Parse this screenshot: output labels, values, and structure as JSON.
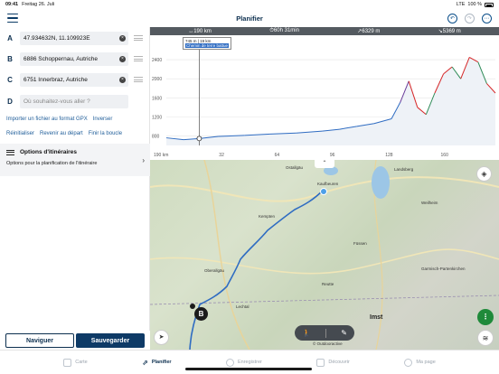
{
  "status": {
    "time": "09:41",
    "date": "Freitag 26. Juli",
    "network": "LTE",
    "battery": "100 %"
  },
  "header": {
    "title": "Planifier"
  },
  "waypoints": [
    {
      "letter": "A",
      "value": "47.934632N, 11.109923E"
    },
    {
      "letter": "B",
      "value": "6886 Schoppernau, Autriche"
    },
    {
      "letter": "C",
      "value": "6751 Innerbraz, Autriche"
    },
    {
      "letter": "D",
      "placeholder": "Où souhaitez-vous aller ?"
    }
  ],
  "links": {
    "import_gpx": "Importer un fichier au format GPX",
    "reverse": "Inverser",
    "reset": "Réinitialiser",
    "back_start": "Revenir au départ",
    "loop": "Finir la boucle"
  },
  "options": {
    "title": "Options d'itinéraires",
    "subtitle": "Options pour la planification de l'itinéraire"
  },
  "buttons": {
    "navigate": "Naviguer",
    "save": "Sauvegarder"
  },
  "stats": {
    "distance": "↔190 km",
    "duration": "⏱60h 31min",
    "ascent": "↗6329 m",
    "descent": "↘5369 m"
  },
  "profile": {
    "tooltip_line1": "745 m | 19 km",
    "tooltip_line2": "Chemin de terre battue",
    "y_ticks": [
      "2400",
      "2000",
      "1600",
      "1200",
      "800"
    ],
    "x_ticks": [
      "190 km",
      "32",
      "64",
      "96",
      "128",
      "160"
    ]
  },
  "chart_data": {
    "type": "area",
    "x": [
      0,
      10,
      19,
      30,
      45,
      60,
      75,
      90,
      100,
      110,
      120,
      130,
      135,
      140,
      145,
      150,
      155,
      160,
      165,
      170,
      175,
      180,
      185,
      190
    ],
    "y": [
      760,
      720,
      745,
      790,
      810,
      840,
      860,
      900,
      940,
      1000,
      1060,
      1160,
      1500,
      1950,
      1400,
      1250,
      1700,
      2100,
      2250,
      2000,
      2450,
      2350,
      1900,
      1700
    ],
    "xlabel": "",
    "ylabel": "",
    "xlim": [
      0,
      190
    ],
    "ylim": [
      600,
      2800
    ],
    "segment_colors": [
      "#2f6cc2",
      "#6a3d9a",
      "#2e8b57",
      "#d62728"
    ]
  },
  "map": {
    "labels": [
      "Ostallgäu",
      "Landsberg",
      "Kaufbeuren",
      "Kempten",
      "Füssen",
      "Imst",
      "Weilheim",
      "Garmisch-Partenkirchen",
      "Oberallgäu",
      "Reutte",
      "Lechtal"
    ],
    "imst_label": "Imst",
    "copyright": "© Outdooractive",
    "marker_b": "B"
  },
  "tabbar": [
    {
      "label": "Carte",
      "active": false
    },
    {
      "label": "Planifier",
      "active": true
    },
    {
      "label": "Enregistrer",
      "active": false
    },
    {
      "label": "Découvrir",
      "active": false
    },
    {
      "label": "Ma page",
      "active": false
    }
  ]
}
